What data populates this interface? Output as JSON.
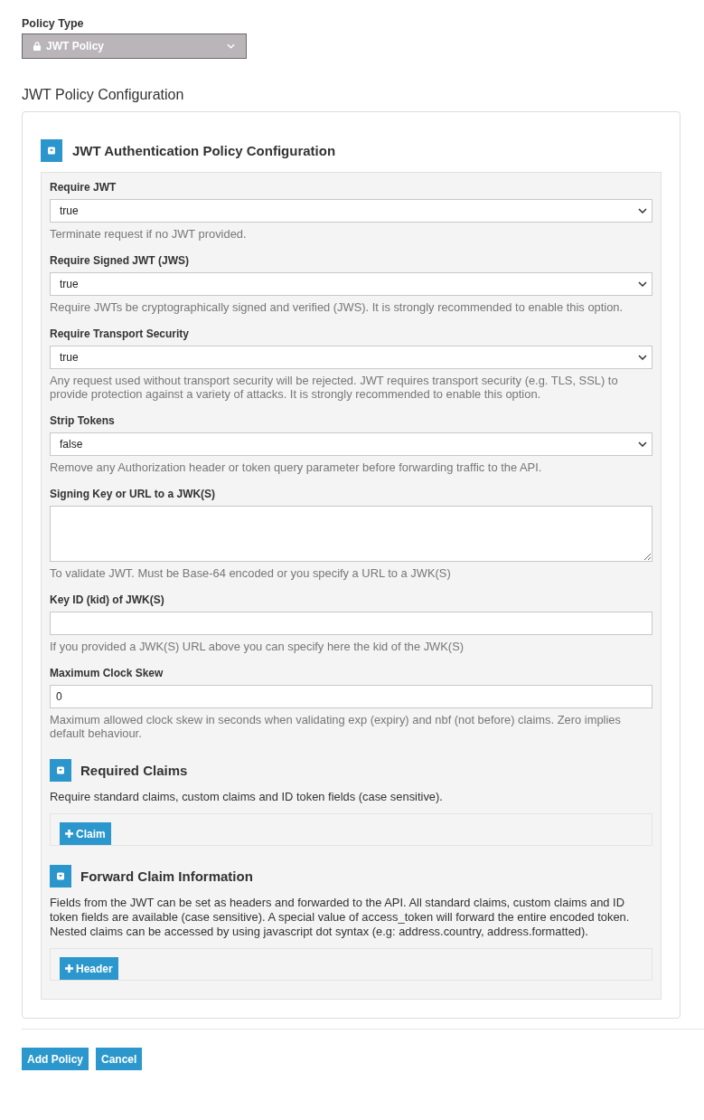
{
  "policy_type": {
    "label": "Policy Type",
    "value": "JWT Policy",
    "disabled": true
  },
  "config_title": "JWT Policy Configuration",
  "section": {
    "title": "JWT Authentication Policy Configuration",
    "expanded": true,
    "fields": [
      {
        "kind": "select",
        "label": "Require JWT",
        "value": "true",
        "help": "Terminate request if no JWT provided."
      },
      {
        "kind": "select",
        "label": "Require Signed JWT (JWS)",
        "value": "true",
        "help": "Require JWTs be cryptographically signed and verified (JWS). It is strongly recommended to enable this option."
      },
      {
        "kind": "select",
        "label": "Require Transport Security",
        "value": "true",
        "help": "Any request used without transport security will be rejected. JWT requires transport security (e.g. TLS, SSL) to provide protection against a variety of attacks. It is strongly recommended to enable this option."
      },
      {
        "kind": "select",
        "label": "Strip Tokens",
        "value": "false",
        "help": "Remove any Authorization header or token query parameter before forwarding traffic to the API."
      },
      {
        "kind": "textarea",
        "label": "Signing Key or URL to a JWK(S)",
        "help": "To validate JWT. Must be Base-64 encoded or you specify a URL to a JWK(S)"
      },
      {
        "kind": "input",
        "label": "Key ID (kid) of JWK(S)",
        "help": "If you provided a JWK(S) URL above you can specify here the kid of the JWK(S)"
      },
      {
        "kind": "input",
        "label": "Maximum Clock Skew",
        "value": "0",
        "help": "Maximum allowed clock skew in seconds when validating exp (expiry) and nbf (not before) claims. Zero implies default behaviour."
      }
    ],
    "subsections": [
      {
        "title": "Required Claims",
        "expanded": true,
        "description": "Require standard claims, custom claims and ID token fields (case sensitive).",
        "button": "Claim"
      },
      {
        "title": "Forward Claim Information",
        "expanded": true,
        "description": "Fields from the JWT can be set as headers and forwarded to the API. All standard claims, custom claims and ID token fields are available (case sensitive). A special value of access_token will forward the entire encoded token. Nested claims can be accessed by using javascript dot syntax (e.g: address.country, address.formatted).",
        "button": "Header"
      }
    ]
  },
  "actions": [
    {
      "label": "Add Policy"
    },
    {
      "label": "Cancel"
    }
  ]
}
